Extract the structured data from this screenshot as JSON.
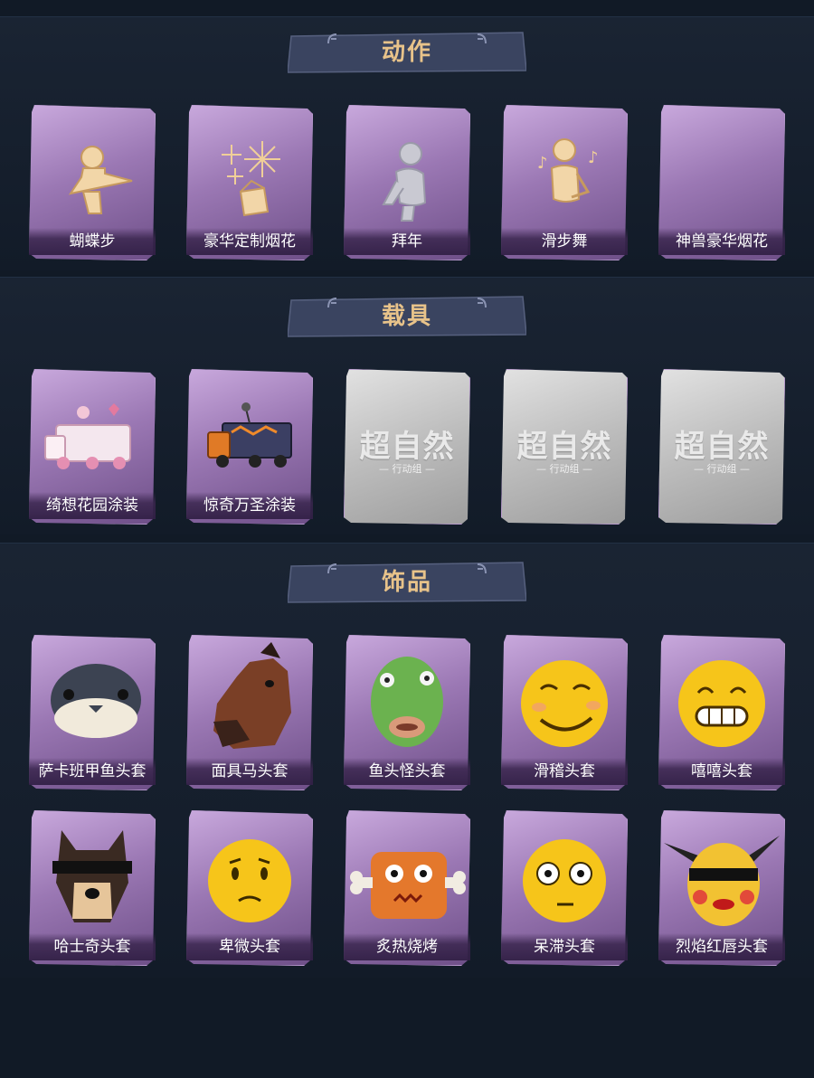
{
  "sections": {
    "actions": {
      "title": "动作",
      "items": [
        {
          "label": "蝴蝶步",
          "icon": "butterfly-step-pose-icon"
        },
        {
          "label": "豪华定制烟花",
          "icon": "fireworks-box-icon"
        },
        {
          "label": "拜年",
          "icon": "new-year-greeting-pose-icon"
        },
        {
          "label": "滑步舞",
          "icon": "slide-dance-music-icon"
        },
        {
          "label": "神兽豪华烟花",
          "icon": "empty-icon"
        }
      ]
    },
    "vehicles": {
      "title": "载具",
      "items": [
        {
          "label": "绮想花园涂装",
          "icon": "pink-garden-truck-icon"
        },
        {
          "label": "惊奇万圣涂装",
          "icon": "halloween-truck-icon"
        },
        {
          "label": "",
          "icon": "locked-watermark-icon",
          "watermark": "超自然",
          "watermark_sub": "— 行动组 —"
        },
        {
          "label": "",
          "icon": "locked-watermark-icon",
          "watermark": "超自然",
          "watermark_sub": "— 行动组 —"
        },
        {
          "label": "",
          "icon": "locked-watermark-icon",
          "watermark": "超自然",
          "watermark_sub": "— 行动组 —"
        }
      ]
    },
    "accessories": {
      "title": "饰品",
      "row1": [
        {
          "label": "萨卡班甲鱼头套",
          "icon": "sacabambaspis-fish-mask-icon"
        },
        {
          "label": "面具马头套",
          "icon": "horse-mask-icon"
        },
        {
          "label": "鱼头怪头套",
          "icon": "fish-monster-mask-icon"
        },
        {
          "label": "滑稽头套",
          "icon": "funny-face-mask-icon"
        },
        {
          "label": "嘻嘻头套",
          "icon": "grin-face-mask-icon"
        }
      ],
      "row2": [
        {
          "label": "哈士奇头套",
          "icon": "husky-sunglasses-mask-icon"
        },
        {
          "label": "卑微头套",
          "icon": "humble-face-mask-icon"
        },
        {
          "label": "炙热烧烤",
          "icon": "bbq-meat-mask-icon"
        },
        {
          "label": "呆滞头套",
          "icon": "dazed-face-mask-icon"
        },
        {
          "label": "烈焰红唇头套",
          "icon": "red-lips-pikachu-mask-icon"
        }
      ]
    }
  },
  "colors": {
    "background": "#111a26",
    "banner": "#3a4460",
    "title_gold": "#e8c38a",
    "card_purple": "#9b78b4",
    "card_grey": "#bdbdbd"
  }
}
